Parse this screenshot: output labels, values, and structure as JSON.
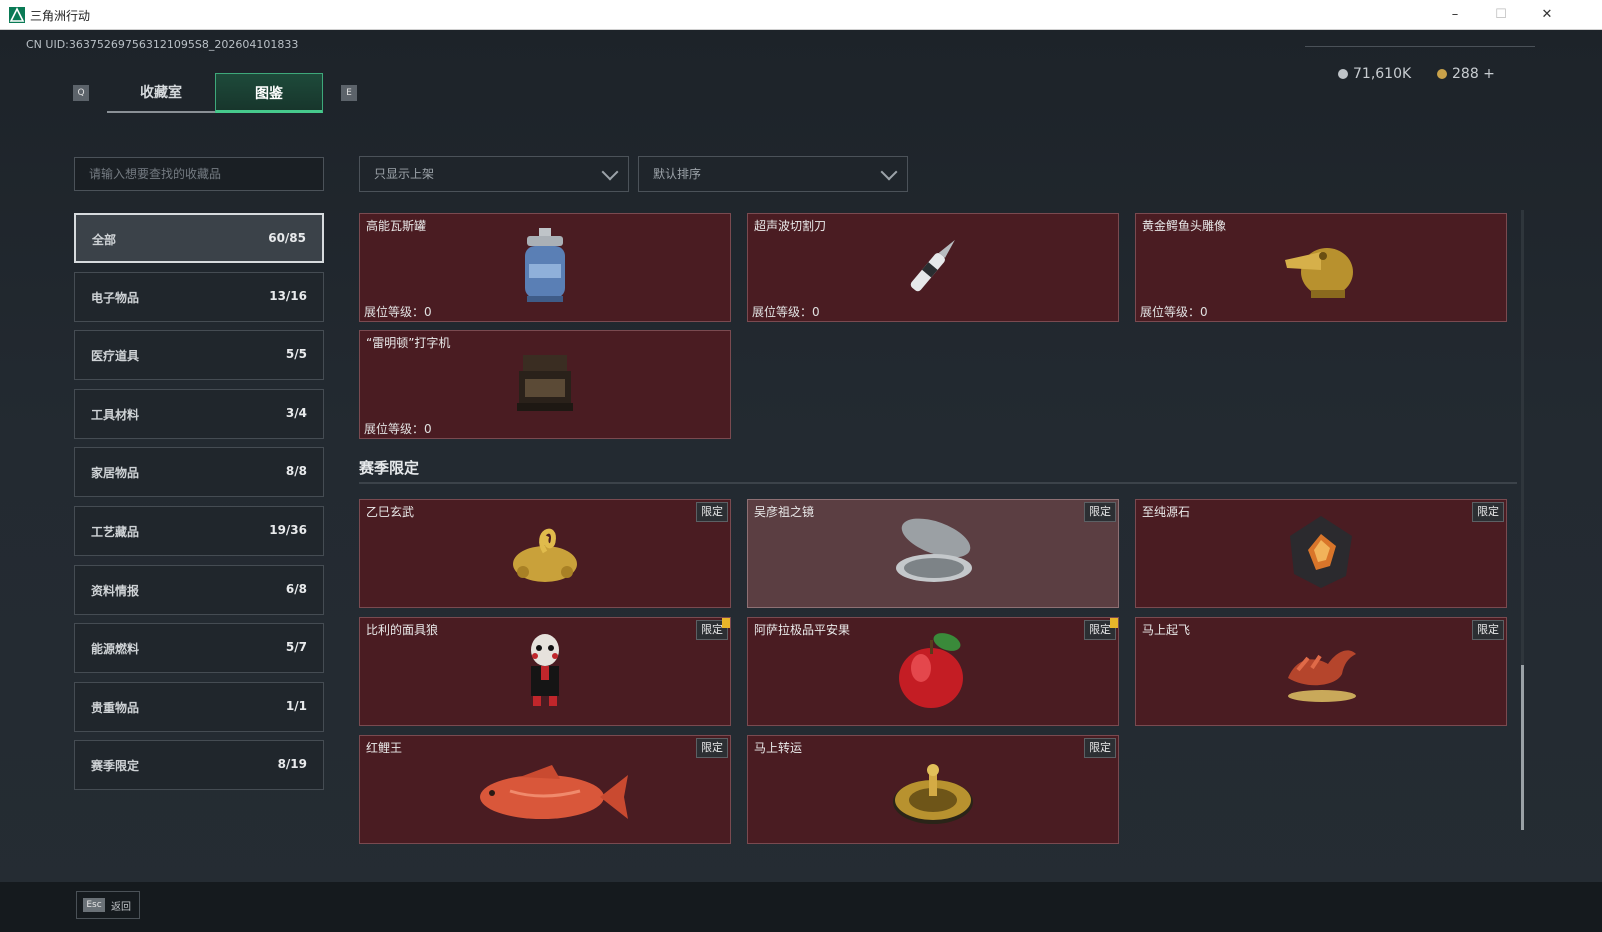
{
  "window": {
    "title": "三角洲行动",
    "min": "–",
    "max": "☐",
    "close": "✕"
  },
  "header": {
    "uid": "CN UID:363752697563121095S8_202604101833",
    "currency1": "71,610K",
    "currency2": "288 +",
    "key_left": "Q",
    "key_right": "E",
    "tabs": [
      "收藏室",
      "图鉴"
    ]
  },
  "search": {
    "placeholder": "请输入想要查找的收藏品"
  },
  "filters": {
    "listing": "只显示上架",
    "sort": "默认排序"
  },
  "categories": [
    {
      "label": "全部",
      "count": "60/85"
    },
    {
      "label": "电子物品",
      "count": "13/16"
    },
    {
      "label": "医疗道具",
      "count": "5/5"
    },
    {
      "label": "工具材料",
      "count": "3/4"
    },
    {
      "label": "家居物品",
      "count": "8/8"
    },
    {
      "label": "工艺藏品",
      "count": "19/36"
    },
    {
      "label": "资料情报",
      "count": "6/8"
    },
    {
      "label": "能源燃料",
      "count": "5/7"
    },
    {
      "label": "贵重物品",
      "count": "1/1"
    },
    {
      "label": "赛季限定",
      "count": "8/19"
    }
  ],
  "level_prefix": "展位等级：",
  "items": [
    {
      "name": "高能瓦斯罐",
      "level": "0",
      "icon": "gas-canister-icon"
    },
    {
      "name": "超声波切割刀",
      "level": "0",
      "icon": "ultrasonic-knife-icon"
    },
    {
      "name": "黄金鳄鱼头雕像",
      "level": "0",
      "icon": "gold-crocodile-statue-icon"
    },
    {
      "name": "“雷明顿”打字机",
      "level": "0",
      "icon": "typewriter-icon"
    }
  ],
  "season_title": "赛季限定",
  "limited_badge": "限定",
  "season_items": [
    {
      "name": "乙巳玄武",
      "icon": "gold-turtle-snake-icon"
    },
    {
      "name": "吴彦祖之镜",
      "icon": "compact-mirror-icon"
    },
    {
      "name": "至纯源石",
      "icon": "source-stone-icon"
    },
    {
      "name": "比利的面具狼",
      "icon": "billy-puppet-icon"
    },
    {
      "name": "阿萨拉极品平安果",
      "icon": "apple-icon"
    },
    {
      "name": "马上起飞",
      "icon": "horse-statue-icon"
    },
    {
      "name": "红鲤王",
      "icon": "red-carp-icon"
    },
    {
      "name": "马上转运",
      "icon": "fortune-compass-icon"
    }
  ],
  "footer": {
    "key": "Esc",
    "label": "返回"
  }
}
